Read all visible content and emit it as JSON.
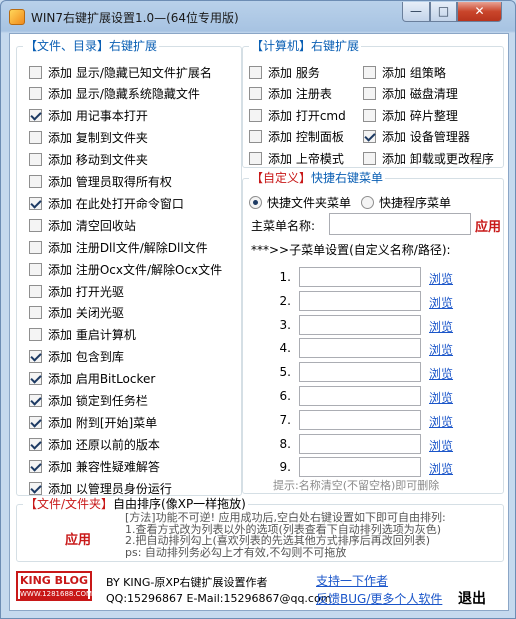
{
  "window": {
    "title": "WIN7右键扩展设置1.0—(64位专用版)",
    "min_label": "—",
    "max_label": "□",
    "close_label": "✕"
  },
  "file_dir": {
    "title_bracket": "【文件、目录】",
    "title_suffix": "右键扩展",
    "items": [
      {
        "label": "添加 显示/隐藏已知文件扩展名",
        "checked": false
      },
      {
        "label": "添加 显示/隐藏系统隐藏文件",
        "checked": false
      },
      {
        "label": "添加 用记事本打开",
        "checked": true
      },
      {
        "label": "添加 复制到文件夹",
        "checked": false
      },
      {
        "label": "添加 移动到文件夹",
        "checked": false
      },
      {
        "label": "添加 管理员取得所有权",
        "checked": false
      },
      {
        "label": "添加 在此处打开命令窗口",
        "checked": true
      },
      {
        "label": "添加 清空回收站",
        "checked": false
      },
      {
        "label": "添加 注册Dll文件/解除Dll文件",
        "checked": false
      },
      {
        "label": "添加 注册Ocx文件/解除Ocx文件",
        "checked": false
      },
      {
        "label": "添加 打开光驱",
        "checked": false
      },
      {
        "label": "添加 关闭光驱",
        "checked": false
      },
      {
        "label": "添加 重启计算机",
        "checked": false
      },
      {
        "label": "添加 包含到库",
        "checked": true
      },
      {
        "label": "添加 启用BitLocker",
        "checked": true
      },
      {
        "label": "添加 锁定到任务栏",
        "checked": true
      },
      {
        "label": "添加 附到[开始]菜单",
        "checked": true
      },
      {
        "label": "添加 还原以前的版本",
        "checked": true
      },
      {
        "label": "添加 兼容性疑难解答",
        "checked": true
      },
      {
        "label": "添加 以管理员身份运行",
        "checked": true
      }
    ]
  },
  "computer": {
    "title_bracket": "【计算机】",
    "title_suffix": "右键扩展",
    "items_left": [
      {
        "label": "添加 服务",
        "checked": false
      },
      {
        "label": "添加 注册表",
        "checked": false
      },
      {
        "label": "添加 打开cmd",
        "checked": false
      },
      {
        "label": "添加 控制面板",
        "checked": false
      },
      {
        "label": "添加 上帝模式",
        "checked": false
      }
    ],
    "items_right": [
      {
        "label": "添加 组策略",
        "checked": false
      },
      {
        "label": "添加 磁盘清理",
        "checked": false
      },
      {
        "label": "添加 碎片整理",
        "checked": false
      },
      {
        "label": "添加 设备管理器",
        "checked": true
      },
      {
        "label": "添加 卸载或更改程序",
        "checked": false
      }
    ]
  },
  "custom": {
    "title_bracket": "【自定义】",
    "title_suffix": "快捷右键菜单",
    "radio_folder": "快捷文件夹菜单",
    "radio_program": "快捷程序菜单",
    "selected": "folder",
    "main_name_label": "主菜单名称:",
    "main_name_value": "",
    "apply_label": "应用",
    "sub_heading": "***>>子菜单设置(自定义名称/路径):",
    "rows": [
      {
        "num": "1.",
        "value": "",
        "browse": "浏览"
      },
      {
        "num": "2.",
        "value": "",
        "browse": "浏览"
      },
      {
        "num": "3.",
        "value": "",
        "browse": "浏览"
      },
      {
        "num": "4.",
        "value": "",
        "browse": "浏览"
      },
      {
        "num": "5.",
        "value": "",
        "browse": "浏览"
      },
      {
        "num": "6.",
        "value": "",
        "browse": "浏览"
      },
      {
        "num": "7.",
        "value": "",
        "browse": "浏览"
      },
      {
        "num": "8.",
        "value": "",
        "browse": "浏览"
      },
      {
        "num": "9.",
        "value": "",
        "browse": "浏览"
      }
    ],
    "hint": "提示:名称清空(不留空格)即可删除"
  },
  "sort": {
    "title_bracket": "【文件/文件夹】",
    "title_suffix": "自由排序(像XP一样拖放)",
    "apply_label": "应用",
    "lines": [
      "[方法]功能不可逆! 应用成功后,空白处右键设置如下即可自由排列:",
      "1.查看方式改为列表以外的选项(列表查看下自动排列选项为灰色)",
      "2.把自动排列勾上(喜欢列表的先选其他方式排序后再改回列表)",
      "    ps: 自动排列务必勾上才有效,不勾则不可拖放"
    ]
  },
  "footer": {
    "logo_top": "KING BLOG",
    "logo_bottom": "WWW.1281688.COM",
    "line1": "BY KING-原XP右键扩展设置作者",
    "line2": "QQ:15296867 E-Mail:15296867@qq.com",
    "support_link": "支持一下作者",
    "feedback_link": "反馈BUG/更多个人软件",
    "exit_label": "退出"
  },
  "colors": {
    "accent_blue": "#0a5fb4",
    "accent_red": "#c81818",
    "link": "#1a55c9"
  }
}
